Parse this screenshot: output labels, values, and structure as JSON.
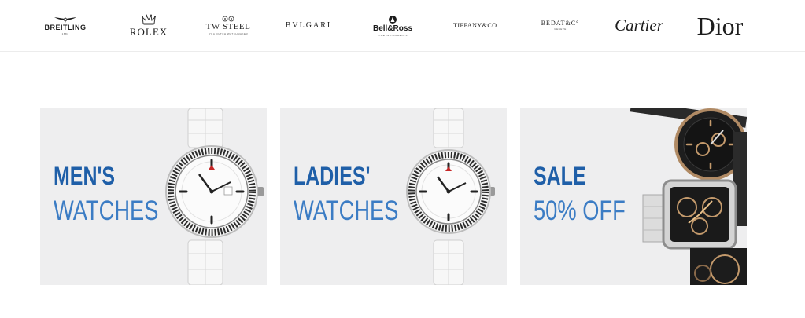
{
  "brands": [
    {
      "name": "BREITLING",
      "sub": "1884"
    },
    {
      "name": "ROLEX"
    },
    {
      "name": "TW STEEL",
      "sub": "BY A DUTCH WATCHMAKER"
    },
    {
      "name": "BVLGARI"
    },
    {
      "name": "Bell&Ross",
      "sub": "TIME INSTRUMENTS"
    },
    {
      "name": "TIFFANY&CO."
    },
    {
      "name": "BEDAT&C°",
      "sub": "GENEVE"
    },
    {
      "name": "Cartier"
    },
    {
      "name": "Dior"
    }
  ],
  "promos": [
    {
      "line1": "MEN'S",
      "line2": "WATCHES"
    },
    {
      "line1": "LADIES'",
      "line2": "WATCHES"
    },
    {
      "line1": "SALE",
      "line2": "50% OFF"
    }
  ],
  "colors": {
    "accent_dark": "#1f5fa8",
    "accent_light": "#3b7cc4",
    "card_bg": "#eeeeef"
  },
  "icons": [
    "breitling-wings-logo",
    "rolex-crown-logo",
    "tw-steel-crest-logo",
    "bell-ross-emblem-logo"
  ]
}
